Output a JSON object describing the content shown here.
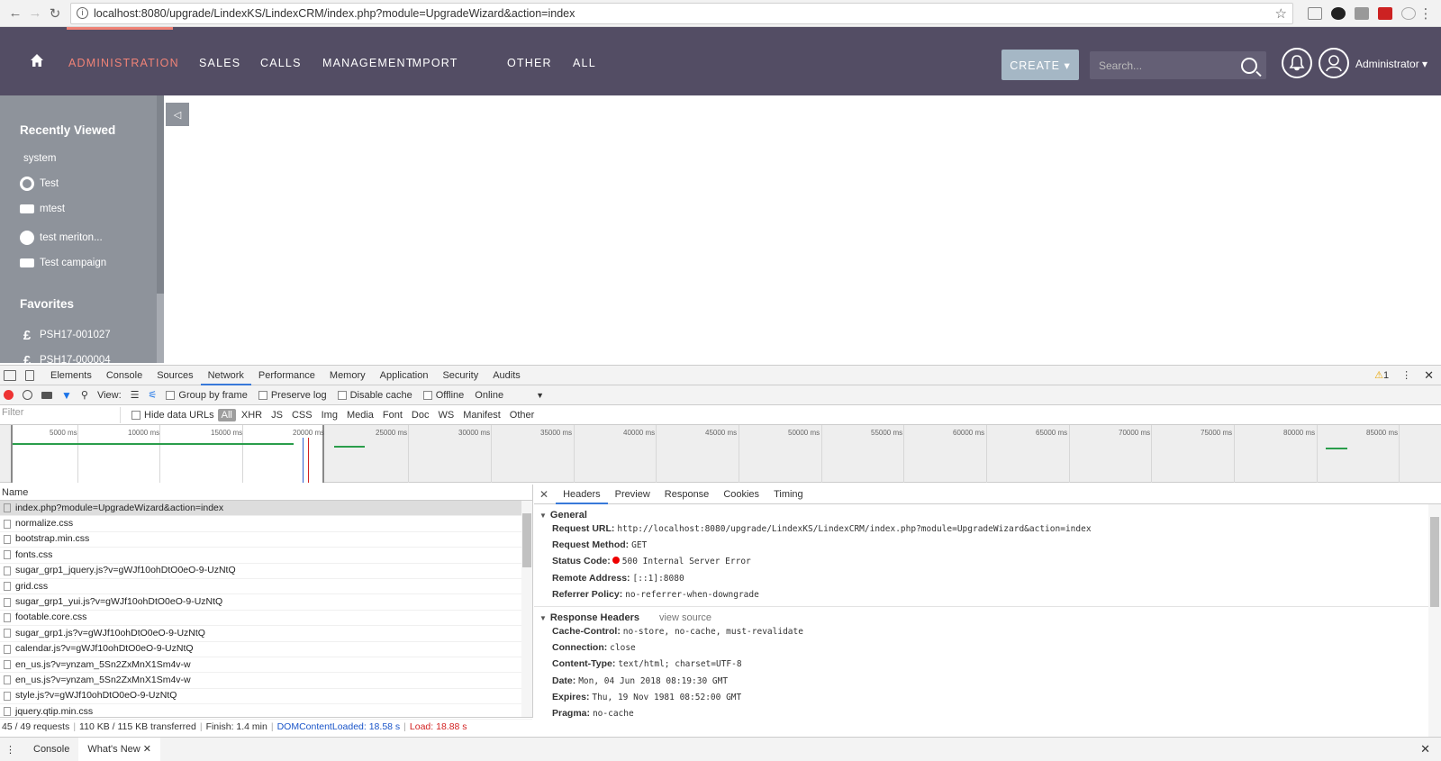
{
  "browser": {
    "url": "localhost:8080/upgrade/LindexKS/LindexCRM/index.php?module=UpgradeWizard&action=index"
  },
  "appnav": {
    "items": [
      "ADMINISTRATION",
      "SALES",
      "CALLS",
      "MANAGEMENT",
      "IMPORT",
      "OTHER",
      "ALL"
    ],
    "create_label": "CREATE ▾",
    "search_placeholder": "Search...",
    "user": "Administrator ▾",
    "active_color": "#f08377"
  },
  "sidebar": {
    "recent_title": "Recently Viewed",
    "recent": [
      {
        "label": "system",
        "icon": "none"
      },
      {
        "label": "Test",
        "icon": "target-icon"
      },
      {
        "label": "mtest",
        "icon": "megaphone-icon"
      },
      {
        "label": "test meriton...",
        "icon": "globe-icon"
      },
      {
        "label": "Test campaign",
        "icon": "megaphone-icon"
      }
    ],
    "favorites_title": "Favorites",
    "favorites": [
      {
        "label": "PSH17-001027",
        "icon": "pound-icon"
      },
      {
        "label": "PSH17-000004",
        "icon": "pound-icon"
      }
    ]
  },
  "devtools": {
    "tabs": [
      "Elements",
      "Console",
      "Sources",
      "Network",
      "Performance",
      "Memory",
      "Application",
      "Security",
      "Audits"
    ],
    "warnings": "1",
    "toolbar": {
      "view": "View:",
      "group_by_frame": "Group by frame",
      "preserve_log": "Preserve log",
      "disable_cache": "Disable cache",
      "offline": "Offline",
      "throttle": "Online"
    },
    "filter_placeholder": "Filter",
    "hide_data_urls": "Hide data URLs",
    "filter_types": [
      "All",
      "XHR",
      "JS",
      "CSS",
      "Img",
      "Media",
      "Font",
      "Doc",
      "WS",
      "Manifest",
      "Other"
    ],
    "timeline_ticks": [
      "5000 ms",
      "10000 ms",
      "15000 ms",
      "20000 ms",
      "25000 ms",
      "30000 ms",
      "35000 ms",
      "40000 ms",
      "45000 ms",
      "50000 ms",
      "55000 ms",
      "60000 ms",
      "65000 ms",
      "70000 ms",
      "75000 ms",
      "80000 ms",
      "85000 ms"
    ],
    "name_header": "Name",
    "requests": [
      "index.php?module=UpgradeWizard&action=index",
      "normalize.css",
      "bootstrap.min.css",
      "fonts.css",
      "sugar_grp1_jquery.js?v=gWJf10ohDtO0eO-9-UzNtQ",
      "grid.css",
      "sugar_grp1_yui.js?v=gWJf10ohDtO0eO-9-UzNtQ",
      "footable.core.css",
      "sugar_grp1.js?v=gWJf10ohDtO0eO-9-UzNtQ",
      "calendar.js?v=gWJf10ohDtO0eO-9-UzNtQ",
      "en_us.js?v=ynzam_5Sn2ZxMnX1Sm4v-w",
      "en_us.js?v=ynzam_5Sn2ZxMnX1Sm4v-w",
      "style.js?v=gWJf10ohDtO0eO-9-UzNtQ",
      "jquery.qtip.min.css"
    ],
    "status": {
      "requests": "45 / 49 requests",
      "transferred": "110 KB / 115 KB transferred",
      "finish": "Finish: 1.4 min",
      "dcl": "DOMContentLoaded: 18.58 s",
      "load": "Load: 18.88 s"
    },
    "detail_tabs": [
      "Headers",
      "Preview",
      "Response",
      "Cookies",
      "Timing"
    ],
    "general_title": "General",
    "general": [
      {
        "k": "Request URL:",
        "v": "http://localhost:8080/upgrade/LindexKS/LindexCRM/index.php?module=UpgradeWizard&action=index"
      },
      {
        "k": "Request Method:",
        "v": "GET"
      },
      {
        "k": "Status Code:",
        "v": "500 Internal Server Error"
      },
      {
        "k": "Remote Address:",
        "v": "[::1]:8080"
      },
      {
        "k": "Referrer Policy:",
        "v": "no-referrer-when-downgrade"
      }
    ],
    "response_title": "Response Headers",
    "view_source": "view source",
    "response": [
      {
        "k": "Cache-Control:",
        "v": "no-store, no-cache, must-revalidate"
      },
      {
        "k": "Connection:",
        "v": "close"
      },
      {
        "k": "Content-Type:",
        "v": "text/html; charset=UTF-8"
      },
      {
        "k": "Date:",
        "v": "Mon, 04 Jun 2018 08:19:30 GMT"
      },
      {
        "k": "Expires:",
        "v": "Thu, 19 Nov 1981 08:52:00 GMT"
      },
      {
        "k": "Pragma:",
        "v": "no-cache"
      }
    ],
    "drawer_tabs": [
      "Console",
      "What's New"
    ]
  }
}
